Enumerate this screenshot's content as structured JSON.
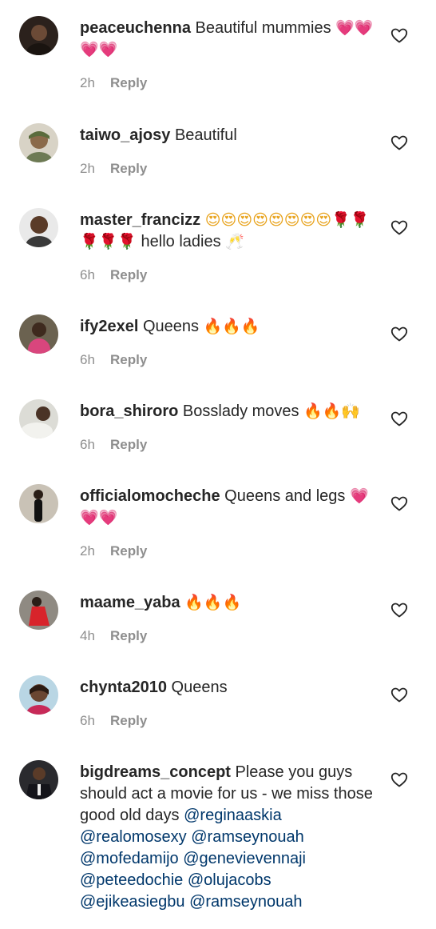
{
  "reply_label": "Reply",
  "icons": {
    "like": "heart-outline-icon"
  },
  "colors": {
    "username": "#262626",
    "meta": "#8e8e8e",
    "mention": "#00376b",
    "heart_emoji": "#e0457b"
  },
  "comments": [
    {
      "username": "peaceuchenna",
      "text": "Beautiful mummies",
      "emojis": "💗💗💗💗",
      "time": "2h"
    },
    {
      "username": "taiwo_ajosy",
      "text": "Beautiful",
      "time": "2h"
    },
    {
      "username": "master_francizz",
      "emojis": "😍😍😍😍😍😍😍😍🌹🌹🌹🌹🌹",
      "text": "hello ladies",
      "emoji_after": "🥂",
      "time": "6h"
    },
    {
      "username": "ify2exel",
      "text": "Queens",
      "emojis": "🔥🔥🔥",
      "time": "6h"
    },
    {
      "username": "bora_shiroro",
      "text": "Bosslady moves",
      "emojis": "🔥🔥🙌",
      "time": "6h"
    },
    {
      "username": "officialomocheche",
      "text": "Queens and legs",
      "emojis": "💗💗💗",
      "time": "2h"
    },
    {
      "username": "maame_yaba",
      "emojis": "🔥🔥🔥",
      "time": "4h"
    },
    {
      "username": "chynta2010",
      "text": "Queens",
      "time": "6h"
    },
    {
      "username": "bigdreams_concept",
      "text": "Please you guys should act a movie for us - we miss those good old days",
      "mentions": [
        "@reginaaskia",
        "@realomosexy",
        "@ramseynouah",
        "@mofedamijo",
        "@genevievennaji",
        "@peteedochie",
        "@olujacobs",
        "@ejikeasiegbu",
        "@ramseynouah"
      ]
    }
  ]
}
